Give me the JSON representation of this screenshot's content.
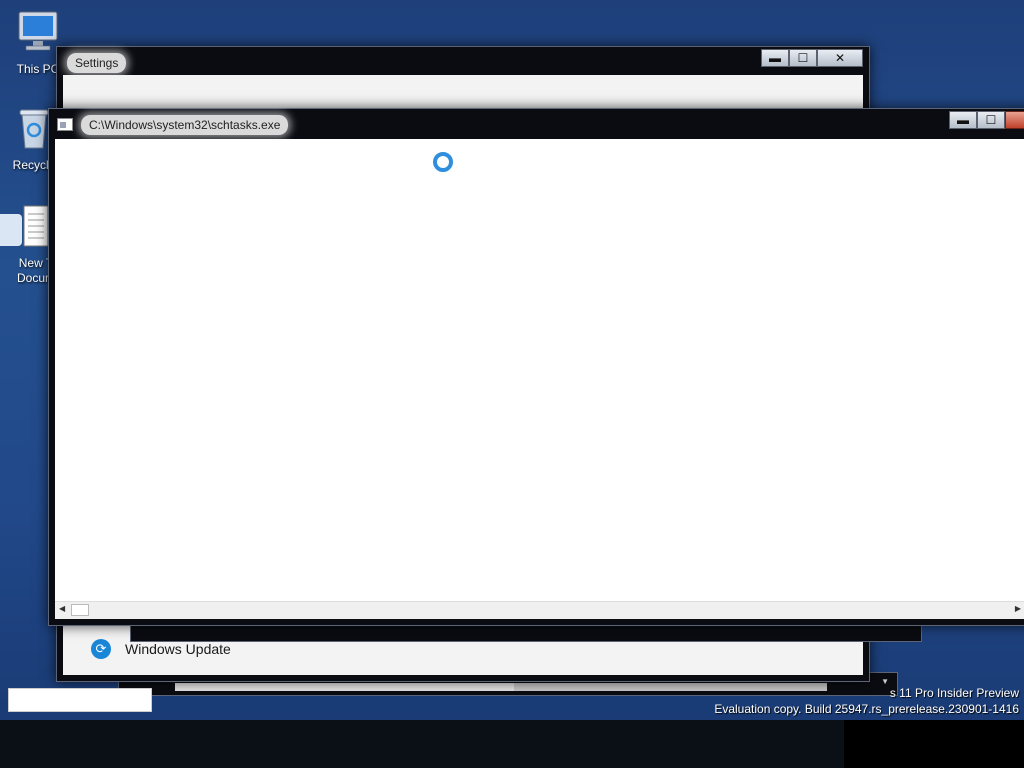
{
  "desktop": {
    "icons": [
      {
        "label": "This PC",
        "icon": "computer-icon"
      },
      {
        "label": "Recycle",
        "icon": "recycle-bin-icon"
      },
      {
        "label": "New T\nDocum",
        "icon": "text-document-icon"
      }
    ],
    "watermark": {
      "line1": "s 11 Pro Insider Preview",
      "line2": "Evaluation copy. Build 25947.rs_prerelease.230901-1416"
    }
  },
  "settings_window": {
    "title": "Settings",
    "controls": {
      "minimize": "▬",
      "maximize": "☐",
      "close": "✕"
    },
    "visible_item": {
      "label": "Windows Update",
      "icon": "sync-icon"
    }
  },
  "schtasks_window": {
    "title": "C:\\Windows\\system32\\schtasks.exe",
    "controls": {
      "minimize": "▬",
      "maximize": "☐",
      "close": "✕"
    },
    "state": "loading",
    "accent_color": "#2f8fde"
  },
  "colors": {
    "desktop": "#22498a",
    "window_frame": "#0a0c12",
    "close_button": "#c0412c"
  }
}
